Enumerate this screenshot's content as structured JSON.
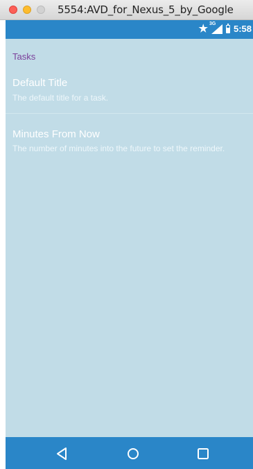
{
  "window": {
    "title": "5554:AVD_for_Nexus_5_by_Google"
  },
  "status_bar": {
    "network": "3G",
    "time": "5:58"
  },
  "preferences": {
    "category": "Tasks",
    "items": [
      {
        "title": "Default Title",
        "summary": "The default title for a task."
      },
      {
        "title": "Minutes From Now",
        "summary": "The number of minutes into the future to set the reminder."
      }
    ]
  },
  "colors": {
    "status_bar": "#2a86c8",
    "background": "#c1dce7",
    "category_text": "#7b3f9a",
    "nav_bar": "#2a86c8"
  },
  "nav_bar": {
    "icons": [
      "back-icon",
      "home-icon",
      "recents-icon"
    ]
  }
}
